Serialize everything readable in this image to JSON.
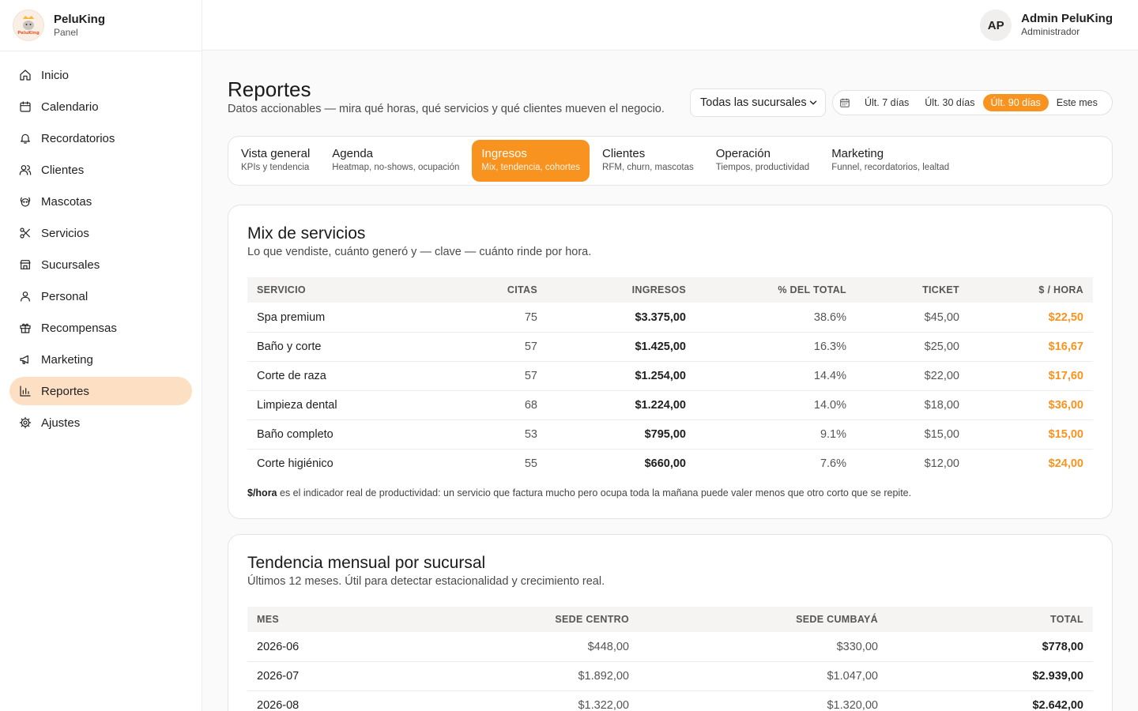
{
  "brand": {
    "name": "PeluKing",
    "subtitle": "Panel",
    "logo_text": "PeluKing"
  },
  "user": {
    "initials": "AP",
    "name": "Admin PeluKing",
    "role": "Administrador"
  },
  "nav": [
    {
      "label": "Inicio",
      "icon": "home-icon"
    },
    {
      "label": "Calendario",
      "icon": "calendar-icon"
    },
    {
      "label": "Recordatorios",
      "icon": "bell-icon"
    },
    {
      "label": "Clientes",
      "icon": "users-icon"
    },
    {
      "label": "Mascotas",
      "icon": "pet-icon"
    },
    {
      "label": "Servicios",
      "icon": "scissors-icon"
    },
    {
      "label": "Sucursales",
      "icon": "store-icon"
    },
    {
      "label": "Personal",
      "icon": "user-icon"
    },
    {
      "label": "Recompensas",
      "icon": "gift-icon"
    },
    {
      "label": "Marketing",
      "icon": "megaphone-icon"
    },
    {
      "label": "Reportes",
      "icon": "bar-chart-icon",
      "active": true
    },
    {
      "label": "Ajustes",
      "icon": "gear-icon"
    }
  ],
  "page": {
    "title": "Reportes",
    "subtitle": "Datos accionables — mira qué horas, qué servicios y qué clientes mueven el negocio."
  },
  "filters": {
    "branch": "Todas las sucursales",
    "ranges": [
      "Últ. 7 días",
      "Últ. 30 días",
      "Últ. 90 días",
      "Este mes"
    ],
    "active_range": 2
  },
  "tabs": [
    {
      "label": "Vista general",
      "sub": "KPIs y tendencia"
    },
    {
      "label": "Agenda",
      "sub": "Heatmap, no-shows, ocupación"
    },
    {
      "label": "Ingresos",
      "sub": "Mix, tendencia, cohortes",
      "active": true
    },
    {
      "label": "Clientes",
      "sub": "RFM, churn, mascotas"
    },
    {
      "label": "Operación",
      "sub": "Tiempos, productividad"
    },
    {
      "label": "Marketing",
      "sub": "Funnel, recordatorios, lealtad"
    }
  ],
  "mix": {
    "title": "Mix de servicios",
    "subtitle": "Lo que vendiste, cuánto generó y — clave — cuánto rinde por hora.",
    "headers": [
      "Servicio",
      "Citas",
      "Ingresos",
      "% del total",
      "Ticket",
      "$ / hora"
    ],
    "rows": [
      [
        "Spa premium",
        "75",
        "$3.375,00",
        "38.6%",
        "$45,00",
        "$22,50"
      ],
      [
        "Baño y corte",
        "57",
        "$1.425,00",
        "16.3%",
        "$25,00",
        "$16,67"
      ],
      [
        "Corte de raza",
        "57",
        "$1.254,00",
        "14.4%",
        "$22,00",
        "$17,60"
      ],
      [
        "Limpieza dental",
        "68",
        "$1.224,00",
        "14.0%",
        "$18,00",
        "$36,00"
      ],
      [
        "Baño completo",
        "53",
        "$795,00",
        "9.1%",
        "$15,00",
        "$15,00"
      ],
      [
        "Corte higiénico",
        "55",
        "$660,00",
        "7.6%",
        "$12,00",
        "$24,00"
      ]
    ],
    "note_bold": "$/hora",
    "note_text": " es el indicador real de productividad: un servicio que factura mucho pero ocupa toda la mañana puede valer menos que otro corto que se repite."
  },
  "trend": {
    "title": "Tendencia mensual por sucursal",
    "subtitle": "Últimos 12 meses. Útil para detectar estacionalidad y crecimiento real.",
    "headers": [
      "Mes",
      "Sede Centro",
      "Sede Cumbayá",
      "Total"
    ],
    "rows": [
      [
        "2026-06",
        "$448,00",
        "$330,00",
        "$778,00"
      ],
      [
        "2026-07",
        "$1.892,00",
        "$1.047,00",
        "$2.939,00"
      ],
      [
        "2026-08",
        "$1.322,00",
        "$1.320,00",
        "$2.642,00"
      ]
    ]
  },
  "colors": {
    "accent": "#f7931e",
    "active_nav_bg": "#fde0c4"
  }
}
